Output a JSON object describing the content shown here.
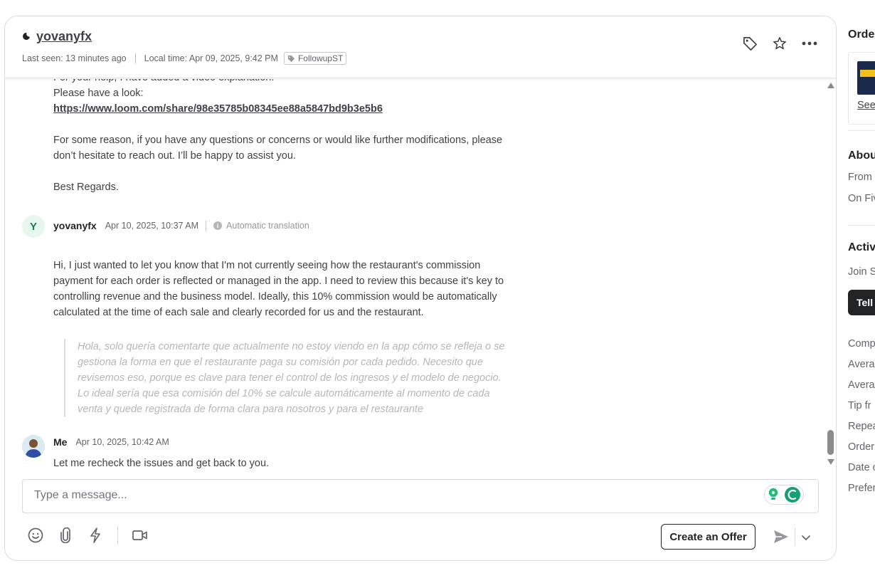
{
  "header": {
    "username": "yovanyfx",
    "last_seen": "Last seen: 13 minutes ago",
    "local_time": "Local time: Apr 09, 2025, 9:42 PM",
    "tag": "FollowupST"
  },
  "messages": {
    "prev_lines": [
      "For your help, I have added a video explanation.",
      "Please have a look:"
    ],
    "prev_link": "https://www.loom.com/share/98e35785b08345ee88a5847bd9b3e5b6",
    "prev_para2": "For some reason, if you have any questions or concerns or would like further modifications, please don’t hesitate to reach out. I’ll be happy to assist you.",
    "prev_regards": "Best Regards.",
    "client": {
      "avatar_letter": "Y",
      "name": "yovanyfx",
      "time": "Apr 10, 2025, 10:37 AM",
      "translation_label": "Automatic translation",
      "text": "Hi, I just wanted to let you know that I'm not currently seeing how the restaurant's commission payment for each order is reflected or managed in the app. I need to review this because it's key to controlling revenue and the business model. Ideally, this 10% commission would be automatically calculated at the time of each sale and clearly recorded for us and the restaurant.",
      "original": "Hola, solo quería comentarte que actualmente no estoy viendo en la app cómo se refleja o se gestiona la forma en que el restaurante paga su comisión por cada pedido. Necesito que revisemos eso, porque es clave para tener el control de los ingresos y el modelo de negocio. Lo ideal sería que esa comisión del 10% se calcule automáticamente al momento de cada venta y quede registrada de forma clara para nosotros y para el restaurante"
    },
    "me": {
      "name": "Me",
      "time": "Apr 10, 2025, 10:42 AM",
      "text": "Let me recheck the issues and get back to you."
    }
  },
  "composer": {
    "placeholder": "Type a message...",
    "offer_label": "Create an Offer"
  },
  "right_panel": {
    "order_title": "Orde",
    "see_link": "See",
    "about_title": "Abou",
    "from": "From",
    "on_fiverr": "On Fiv",
    "activity_title": "Activi",
    "join": "Join S",
    "tell_button": "Tell",
    "stats": [
      "Comp",
      "Avera",
      "Avera",
      "Tip fr",
      "Repea",
      "Order",
      "Date o",
      "Prefer"
    ]
  },
  "colors": {
    "accent_green": "#1dbf73",
    "text": "#404145",
    "muted": "#62646a"
  }
}
